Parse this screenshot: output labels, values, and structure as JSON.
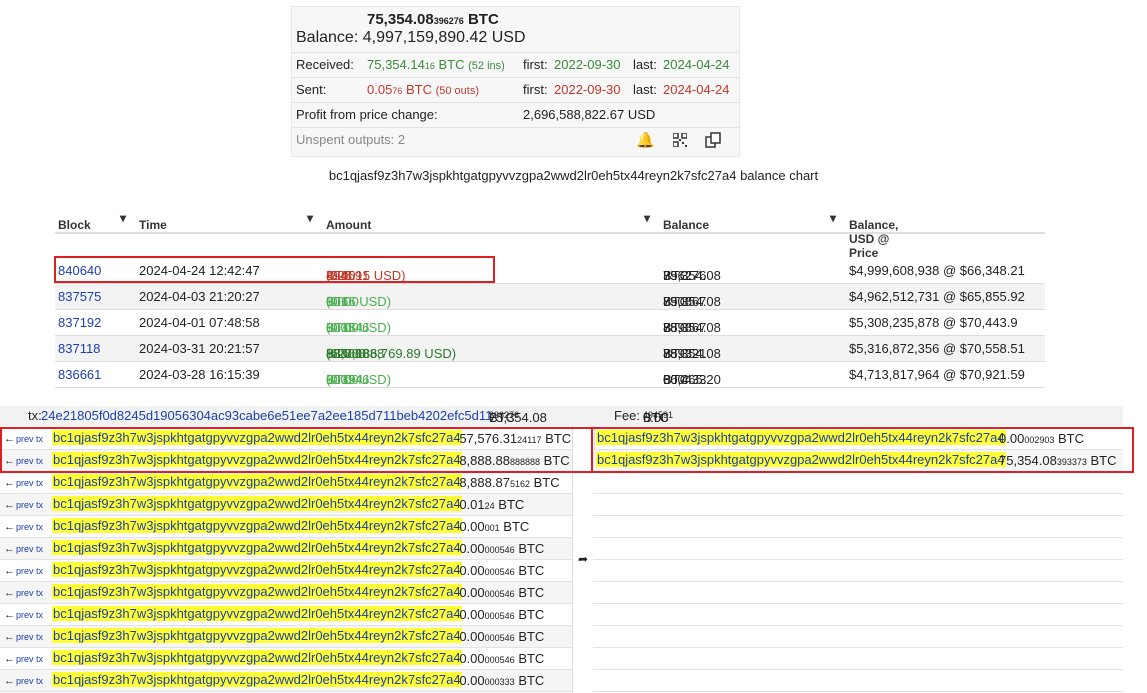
{
  "summary": {
    "btc_main": "75,354.08",
    "btc_small": "396276",
    "btc_unit": "BTC",
    "balance_label": "Balance:",
    "balance_usd": "4,997,159,890.42 USD",
    "received_label": "Received:",
    "received_main": "75,354.14",
    "received_small": "16",
    "received_unit": "BTC",
    "received_ins": "(52 ins)",
    "received_first_label": "first:",
    "received_first": "2022-09-30",
    "received_last_label": "last:",
    "received_last": "2024-04-24",
    "sent_label": "Sent:",
    "sent_main": "0.05",
    "sent_small": "76",
    "sent_unit": "BTC",
    "sent_outs": "(50 outs)",
    "sent_first_label": "first:",
    "sent_first": "2022-09-30",
    "sent_last_label": "last:",
    "sent_last": "2024-04-24",
    "profit_label": "Profit from price change:",
    "profit_value": "2,696,588,822.67 USD",
    "unspent_label": "Unspent outputs: 2"
  },
  "chart_title": "bc1qjasf9z3h7w3jspkhtgatgpyvvzgpa2wwd2lr0eh5tx44reyn2k7sfc27a4 balance chart",
  "history": {
    "headers": [
      "Block",
      "Time",
      "Amount",
      "Balance",
      "Balance, USD @ Price"
    ],
    "rows": [
      {
        "block": "840640",
        "time": "2024-04-24 12:42:47",
        "amt_main": "-0.00",
        "amt_small": "494591",
        "amt_unit": "BTC",
        "amt_usd": "(328.15 USD)",
        "bal_main": "75,354.08",
        "bal_small": "396276",
        "bal_unit": "BTC",
        "usd": "$4,999,608,938 @ $66,348.21"
      },
      {
        "block": "837575",
        "time": "2024-04-03 21:20:27",
        "amt_main": "+0.00",
        "amt_small": "001",
        "amt_unit": "BTC",
        "amt_usd": "(0.66 USD)",
        "bal_main": "75,354.08",
        "bal_small": "890867",
        "bal_unit": "BTC",
        "usd": "$4,962,512,731 @ $65,855.92"
      },
      {
        "block": "837192",
        "time": "2024-04-01 07:48:58",
        "amt_main": "+0.00",
        "amt_small": "000546",
        "amt_unit": "BTC",
        "amt_usd": "(0.38 USD)",
        "bal_main": "75,354.08",
        "bal_small": "889867",
        "bal_unit": "BTC",
        "usd": "$5,308,235,878 @ $70,443.9"
      },
      {
        "block": "837118",
        "time": "2024-03-31 20:21:57",
        "amt_main": "+8,888.88",
        "amt_small": "888888",
        "amt_unit": "BTC",
        "amt_usd": "(627,186,769.89 USD)",
        "bal_main": "75,354.08",
        "bal_small": "889321",
        "bal_unit": "BTC",
        "usd": "$5,316,872,356 @ $70,558.51"
      },
      {
        "block": "836661",
        "time": "2024-03-28 16:15:39",
        "amt_main": "+0.00",
        "amt_small": "000546",
        "amt_unit": "BTC",
        "amt_usd": "(0.39 USD)",
        "bal_main": "66,465.20",
        "bal_small": "000433",
        "bal_unit": "BTC",
        "usd": "$4,713,817,964 @ $70,921.59"
      }
    ]
  },
  "tx": {
    "prefix": "tx:",
    "hash": "24e21805f0d8245d19056304ac93cabe6e51ee7a2ee185d711beb4202efc5d11",
    "total_main": "75,354.08",
    "total_small": "396276",
    "total_unit": "BTC",
    "fee_label": "Fee:",
    "fee_main": "0.00",
    "fee_small": "494591",
    "fee_unit": "BTC",
    "prev_label": "prev tx",
    "address": "bc1qjasf9z3h7w3jspkhtgatgpyvvzgpa2wwd2lr0eh5tx44reyn2k7sfc27a4",
    "inputs": [
      {
        "main": "-57,576.31",
        "small": "24117",
        "unit": "BTC"
      },
      {
        "main": "-8,888.88",
        "small": "888888",
        "unit": "BTC"
      },
      {
        "main": "-8,888.87",
        "small": "5162",
        "unit": "BTC"
      },
      {
        "main": "-0.01",
        "small": "24",
        "unit": "BTC"
      },
      {
        "main": "-0.00",
        "small": "001",
        "unit": "BTC"
      },
      {
        "main": "-0.00",
        "small": "000546",
        "unit": "BTC"
      },
      {
        "main": "-0.00",
        "small": "000546",
        "unit": "BTC"
      },
      {
        "main": "-0.00",
        "small": "000546",
        "unit": "BTC"
      },
      {
        "main": "-0.00",
        "small": "000546",
        "unit": "BTC"
      },
      {
        "main": "-0.00",
        "small": "000546",
        "unit": "BTC"
      },
      {
        "main": "-0.00",
        "small": "000546",
        "unit": "BTC"
      },
      {
        "main": "-0.00",
        "small": "000333",
        "unit": "BTC"
      }
    ],
    "outputs": [
      {
        "main": "0.00",
        "small": "002903",
        "unit": "BTC"
      },
      {
        "main": "75,354.08",
        "small": "393373",
        "unit": "BTC"
      }
    ]
  }
}
